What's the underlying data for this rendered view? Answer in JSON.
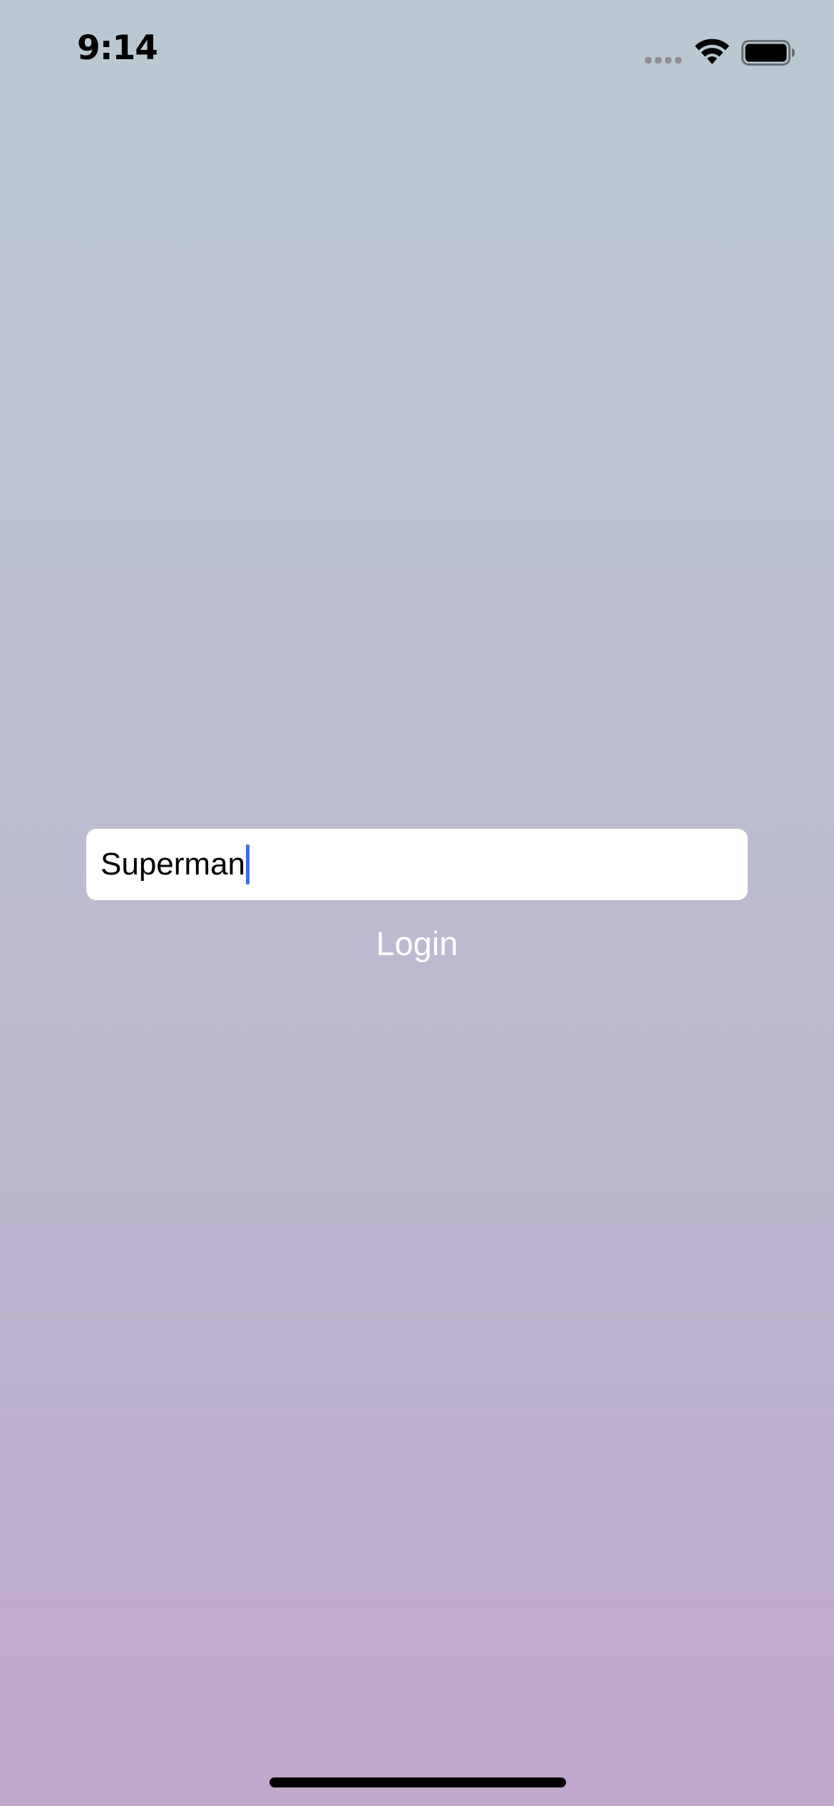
{
  "status_bar": {
    "time": "9:14",
    "icons": [
      "cellular-signal-icon",
      "wifi-icon",
      "battery-icon"
    ]
  },
  "login_form": {
    "username_value": "Superman",
    "login_label": "Login"
  },
  "colors": {
    "background_top": "#bac9d1",
    "background_bottom": "#c2a8cb",
    "caret": "#3b6bf2",
    "field_background": "#ffffff",
    "login_text": "#ffffff"
  }
}
